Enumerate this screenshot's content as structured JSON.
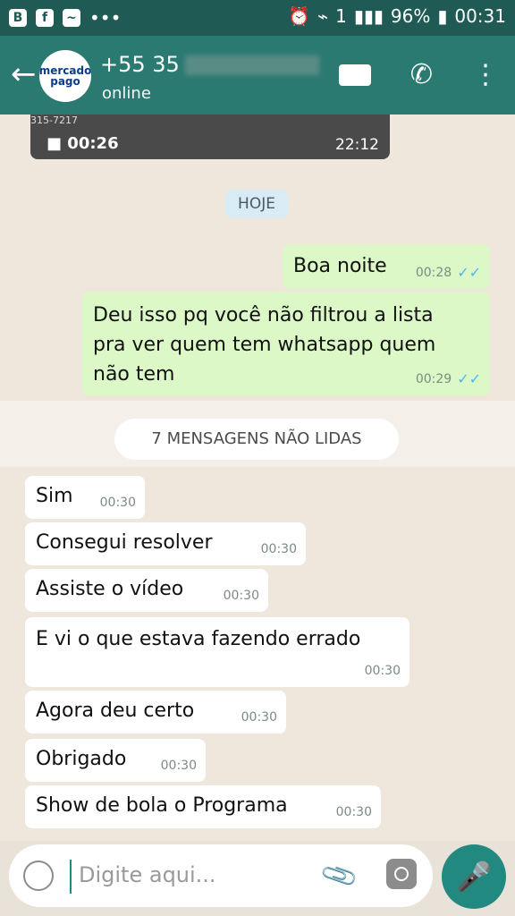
{
  "status_bar": {
    "icons": [
      "b-icon",
      "facebook-icon",
      "messenger-icon",
      "more-dots"
    ],
    "battery": "96%",
    "time": "00:31",
    "sim": "1"
  },
  "header": {
    "contact_name_visible": "+55 35",
    "status": "online",
    "avatar_text": "mercado pago",
    "icons": [
      "video-call-icon",
      "voice-call-icon",
      "menu-icon"
    ]
  },
  "video_message": {
    "duration": "00:26",
    "time": "22:12",
    "number_fragment": "315-7217"
  },
  "date_chip": "HOJE",
  "messages_out": [
    {
      "text": "Boa noite",
      "time": "00:28"
    },
    {
      "text": "Deu isso pq você não filtrou a lista pra ver quem tem whatsapp quem não tem",
      "time": "00:29"
    }
  ],
  "unread_label": "7 MENSAGENS NÃO LIDAS",
  "messages_in": [
    {
      "text": "Sim",
      "time": "00:30"
    },
    {
      "text": "Consegui resolver",
      "time": "00:30"
    },
    {
      "text": "Assiste o vídeo",
      "time": "00:30"
    },
    {
      "text": "E vi o que estava fazendo errado",
      "time": "00:30"
    },
    {
      "text": "Agora deu certo",
      "time": "00:30"
    },
    {
      "text": "Obrigado",
      "time": "00:30"
    },
    {
      "text": "Show de bola o Programa",
      "time": "00:30"
    }
  ],
  "composer": {
    "placeholder": "Digite aqui...",
    "icons": [
      "emoji-icon",
      "attach-icon",
      "camera-icon",
      "mic-icon"
    ]
  }
}
